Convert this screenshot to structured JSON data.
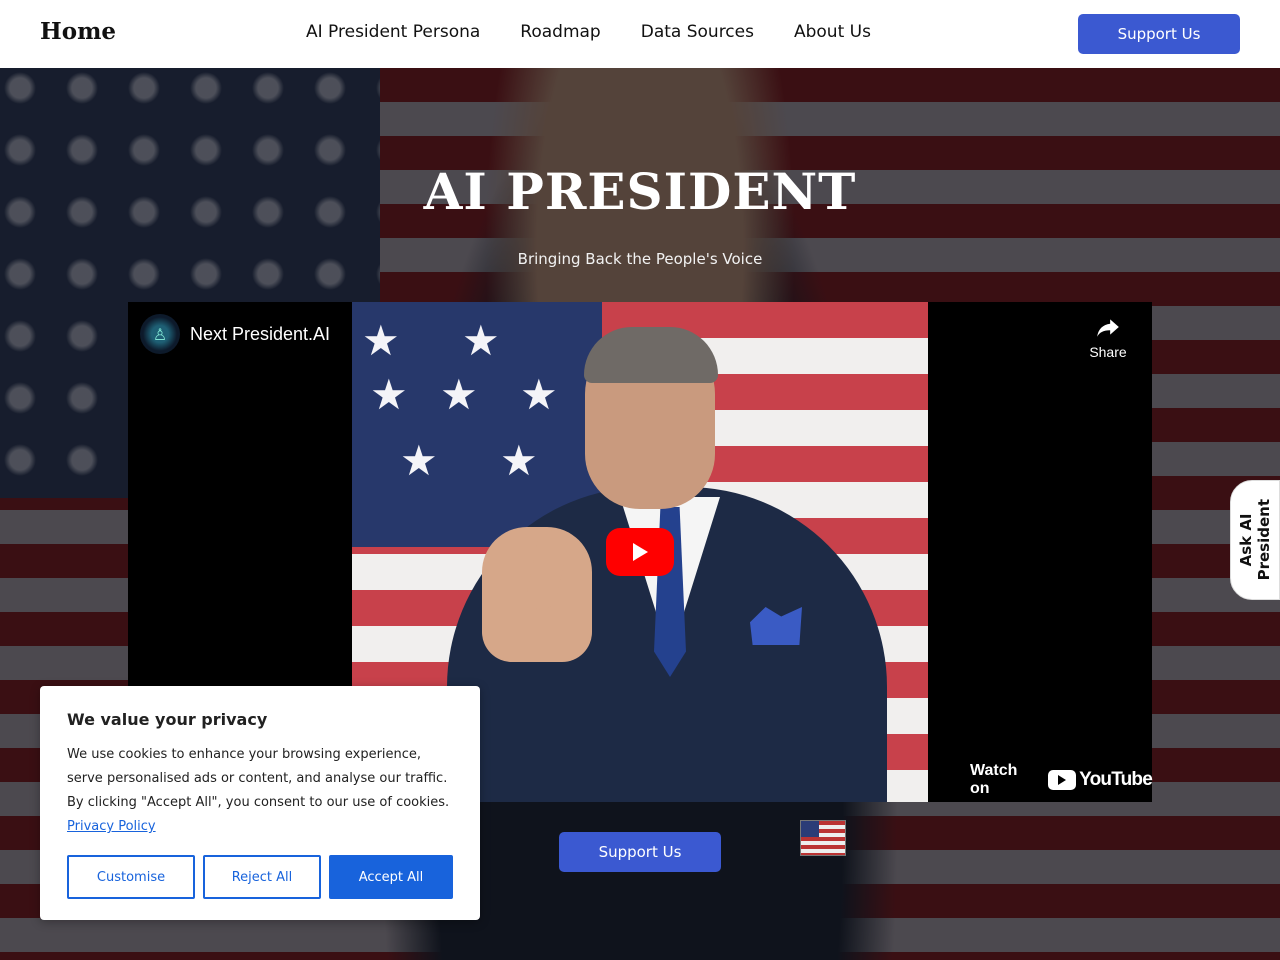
{
  "header": {
    "logo": "Home",
    "nav": [
      "AI President Persona",
      "Roadmap",
      "Data Sources",
      "About Us"
    ],
    "support_label": "Support Us"
  },
  "hero": {
    "title": "AI PRESIDENT",
    "subtitle": "Bringing Back the People's Voice",
    "support_label": "Support Us"
  },
  "video": {
    "channel_name": "Next President.AI",
    "share_label": "Share",
    "watch_on_label": "Watch on",
    "youtube_wordmark": "YouTube"
  },
  "side_tab": {
    "label": "Ask AI\nPresident"
  },
  "cookie": {
    "title": "We value your privacy",
    "text": "We use cookies to enhance your browsing experience, serve personalised ads or content, and analyse our traffic. By clicking \"Accept All\", you consent to our use of cookies.",
    "link_label": "Privacy Policy",
    "customise_label": "Customise",
    "reject_label": "Reject All",
    "accept_label": "Accept All"
  },
  "colors": {
    "brand_button": "#3b59d1",
    "cookie_accent": "#1863dc",
    "youtube_red": "#ff0000"
  },
  "icons": [
    "share-icon",
    "play-icon",
    "youtube-logo-icon",
    "channel-avatar"
  ]
}
